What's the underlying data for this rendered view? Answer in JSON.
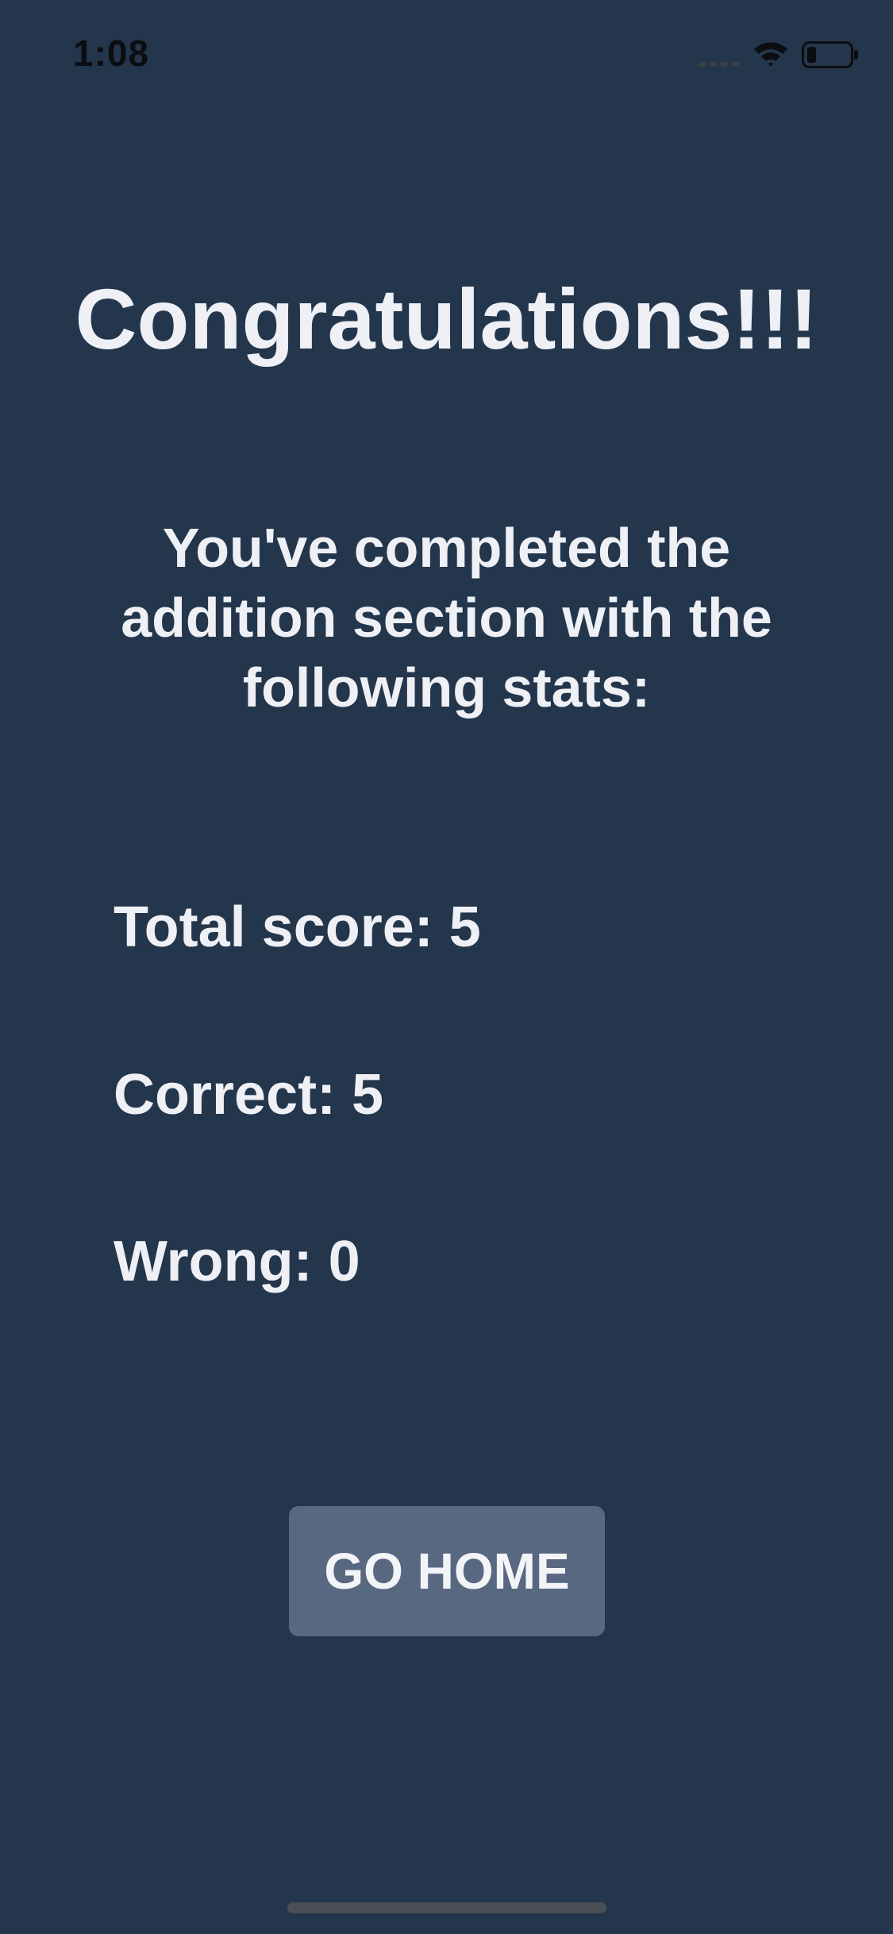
{
  "status_bar": {
    "time": "1:08",
    "icons": [
      "cellular-signal-icon",
      "wifi-icon",
      "battery-icon"
    ]
  },
  "screen": {
    "title": "Congratulations!!!",
    "subtitle": "You've completed the addition section with the following stats:",
    "stats": {
      "total_score": "Total score: 5",
      "correct": "Correct: 5",
      "wrong": "Wrong: 0"
    },
    "go_home_label": "GO HOME"
  },
  "colors": {
    "background": "#24364b",
    "text": "#eef0f6",
    "button": "#586880"
  }
}
